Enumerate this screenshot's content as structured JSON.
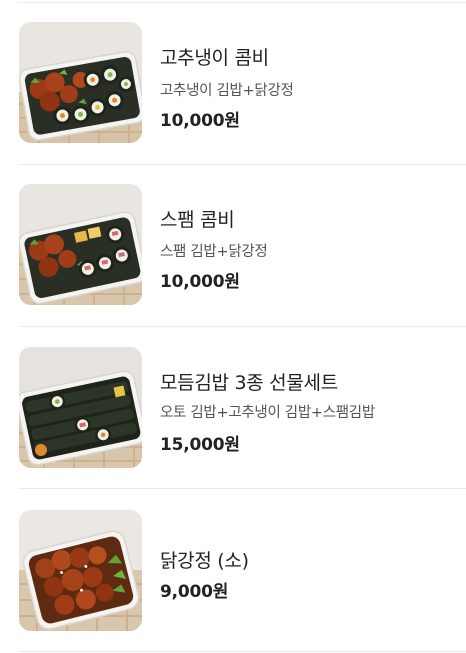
{
  "menu": {
    "items": [
      {
        "name": "고추냉이 콤비",
        "description": "고추냉이 김밥+닭강정",
        "price": "10,000원",
        "photo": "gimbap-chicken-combo-box"
      },
      {
        "name": "스팸 콤비",
        "description": "스팸 김밥+닭강정",
        "price": "10,000원",
        "photo": "gimbap-chicken-combo-box"
      },
      {
        "name": "모듬김밥 3종 선물세트",
        "description": "오토 김밥+고추냉이 김밥+스팸김밥",
        "price": "15,000원",
        "photo": "assorted-gimbap-box"
      },
      {
        "name": "닭강정 (소)",
        "description": "",
        "price": "9,000원",
        "photo": "fried-chicken-box"
      }
    ]
  },
  "colors": {
    "text_primary": "#222222",
    "text_secondary": "#555555",
    "divider": "#ececec"
  }
}
